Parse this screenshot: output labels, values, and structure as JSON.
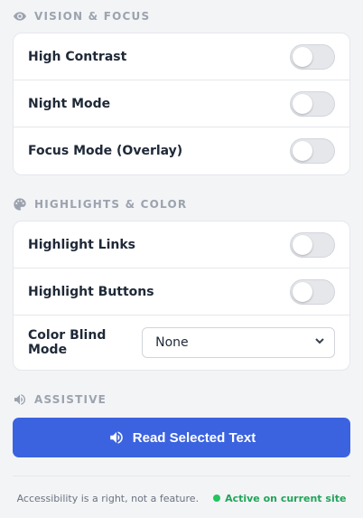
{
  "sections": {
    "vision": {
      "title": "VISION & FOCUS",
      "icon": "eye-icon",
      "items": [
        {
          "label": "High Contrast",
          "enabled": false
        },
        {
          "label": "Night Mode",
          "enabled": false
        },
        {
          "label": "Focus Mode (Overlay)",
          "enabled": false
        }
      ]
    },
    "highlights": {
      "title": "HIGHLIGHTS & COLOR",
      "icon": "palette-icon",
      "items": [
        {
          "label": "Highlight Links",
          "enabled": false
        },
        {
          "label": "Highlight Buttons",
          "enabled": false
        }
      ],
      "color_blind": {
        "label": "Color Blind Mode",
        "value": "None"
      }
    },
    "assistive": {
      "title": "ASSISTIVE",
      "icon": "speaker-icon",
      "read_button": {
        "label": "Read Selected Text",
        "icon": "speaker-icon"
      }
    }
  },
  "footer": {
    "tagline": "Accessibility is a right, not a feature.",
    "status": "Active on current site",
    "status_color": "#22c55e"
  },
  "colors": {
    "accent": "#3b63e0",
    "muted": "#9ca3af",
    "toggle_off": "#e5e7eb"
  }
}
